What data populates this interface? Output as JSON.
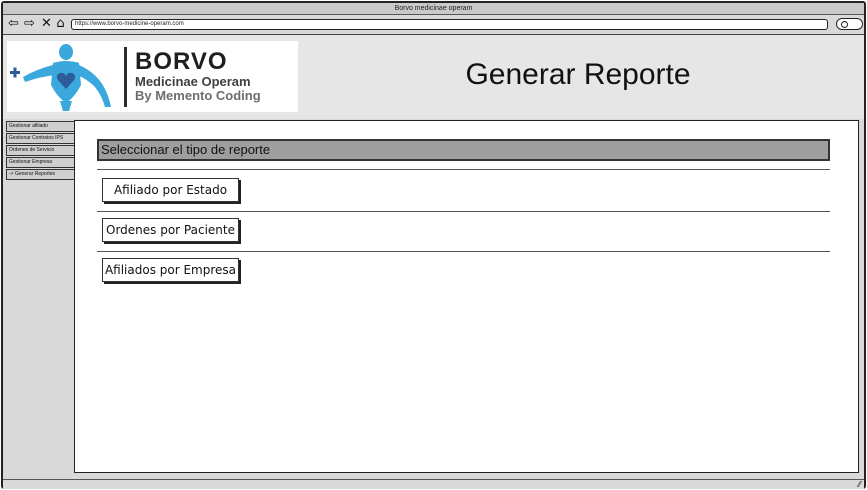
{
  "window": {
    "title": "Borvo medicinae operam",
    "url": "https://www.borvo-medicine-operam.com"
  },
  "nav": {
    "back_icon": "back-arrow-icon",
    "forward_icon": "forward-arrow-icon",
    "close_icon": "stop-icon",
    "home_icon": "home-icon"
  },
  "logo": {
    "title": "BORVO",
    "subtitle": "Medicinae Operam",
    "tagline": "By Memento Coding"
  },
  "header": {
    "title": "Generar Reporte"
  },
  "sidebar": {
    "items": [
      {
        "label": "Gestionar afiliado"
      },
      {
        "label": "Gestionar Contratos IPS"
      },
      {
        "label": "Ordenes de Servicio"
      },
      {
        "label": "Gestionar Empresa"
      },
      {
        "label": "-> Generar Reportes"
      }
    ]
  },
  "main": {
    "section_title": "Seleccionar el tipo de reporte",
    "reports": [
      {
        "label": "Afiliado por Estado"
      },
      {
        "label": "Ordenes por Paciente"
      },
      {
        "label": "Afiliados por Empresa"
      }
    ]
  },
  "colors": {
    "window_bg": "#d9d9d9",
    "section_header_bg": "#9e9e9e",
    "logo_figure": "#3aa7dd",
    "logo_heart": "#2f5b9b"
  }
}
